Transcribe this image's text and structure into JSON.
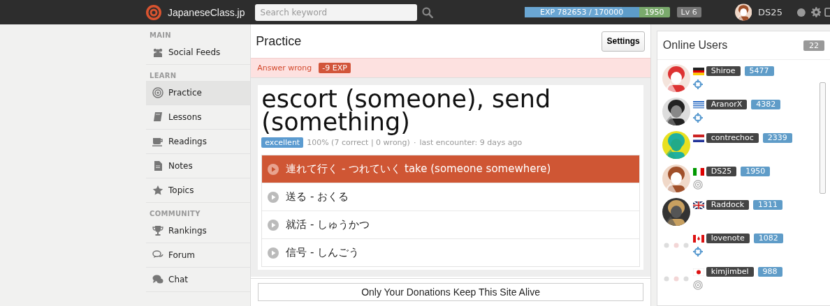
{
  "topbar": {
    "site_name": "JapaneseClass.jp",
    "search": {
      "placeholder": "Search keyword"
    },
    "exp": {
      "text": "EXP 782653 / 170000",
      "level": 0.85,
      "points": "1950"
    },
    "rank": "Lv 6",
    "user": "DS25"
  },
  "sidebar": [
    {
      "heading": "MAIN",
      "items": [
        {
          "label": "Social Feeds",
          "selected": false
        }
      ]
    },
    {
      "heading": "LEARN",
      "items": [
        {
          "label": "Practice",
          "selected": true
        },
        {
          "label": "Lessons",
          "selected": false
        },
        {
          "label": "Readings",
          "selected": false
        },
        {
          "label": "Notes",
          "selected": false
        },
        {
          "label": "Topics",
          "selected": false
        }
      ]
    },
    {
      "heading": "COMMUNITY",
      "items": [
        {
          "label": "Rankings",
          "selected": false
        },
        {
          "label": "Forum",
          "selected": false
        },
        {
          "label": "Chat",
          "selected": false
        }
      ]
    }
  ],
  "practice": {
    "title": "Practice",
    "settings_button": "Settings",
    "feedback": {
      "message": "Answer wrong",
      "badge": "-9 EXP"
    },
    "question": "escort (someone), send (something)",
    "grade": "excellent",
    "stats": "100% (7 correct | 0 wrong)",
    "separator": "·",
    "last_encounter": "last encounter: 9 days ago",
    "choices": [
      {
        "text": "連れて行く - つれていく  take (someone somewhere)",
        "selected": true
      },
      {
        "text": "送る - おくる",
        "selected": false
      },
      {
        "text": "就活 - しゅうかつ",
        "selected": false
      },
      {
        "text": "信号 - しんごう",
        "selected": false
      }
    ],
    "donation": "Only Your Donations Keep This Site Alive"
  },
  "online_users": {
    "title": "Online Users",
    "count": "22",
    "users": [
      {
        "name": "Shiroe",
        "score": "5477",
        "kind": "picture"
      },
      {
        "name": "AranorX",
        "score": "4382",
        "kind": "picture"
      },
      {
        "name": "contrechoc",
        "score": "2339",
        "kind": "picture"
      },
      {
        "name": "DS25",
        "score": "1950",
        "kind": "picture"
      },
      {
        "name": "Raddock",
        "score": "1311",
        "kind": "picture"
      },
      {
        "name": "lovenote",
        "score": "1082",
        "kind": "placeholder"
      },
      {
        "name": "kimjimbel",
        "score": "988",
        "kind": "placeholder"
      }
    ]
  }
}
